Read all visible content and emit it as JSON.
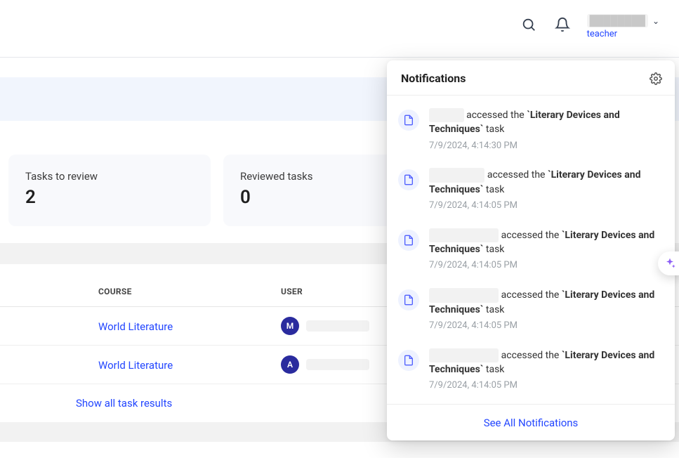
{
  "header": {
    "user_name": "████████",
    "user_role": "teacher"
  },
  "cards": {
    "tasks_to_review": {
      "label": "Tasks to review",
      "value": "2"
    },
    "reviewed_tasks": {
      "label": "Reviewed tasks",
      "value": "0"
    }
  },
  "table": {
    "headers": {
      "course": "COURSE",
      "user": "USER"
    },
    "rows": [
      {
        "course": "World Literature",
        "avatar_initial": "M"
      },
      {
        "course": "World Literature",
        "avatar_initial": "A"
      }
    ],
    "show_all": "Show all task results"
  },
  "notifications": {
    "title": "Notifications",
    "see_all": "See All Notifications",
    "items": [
      {
        "actor": "█████",
        "verb": " accessed the ",
        "task": "`Literary Devices and Techniques`",
        "suffix": " task",
        "time": "7/9/2024, 4:14:30 PM"
      },
      {
        "actor": "████████",
        "verb": " accessed the ",
        "task": "`Literary Devices and Techniques`",
        "suffix": " task",
        "time": "7/9/2024, 4:14:05 PM"
      },
      {
        "actor": "██████████",
        "verb": " accessed the ",
        "task": "`Literary Devices and Techniques`",
        "suffix": " task",
        "time": "7/9/2024, 4:14:05 PM"
      },
      {
        "actor": "██████████",
        "verb": " accessed the ",
        "task": "`Literary Devices and Techniques`",
        "suffix": " task",
        "time": "7/9/2024, 4:14:05 PM"
      },
      {
        "actor": "██████████",
        "verb": " accessed the ",
        "task": "`Literary Devices and Techniques`",
        "suffix": " task",
        "time": "7/9/2024, 4:14:05 PM"
      }
    ]
  }
}
